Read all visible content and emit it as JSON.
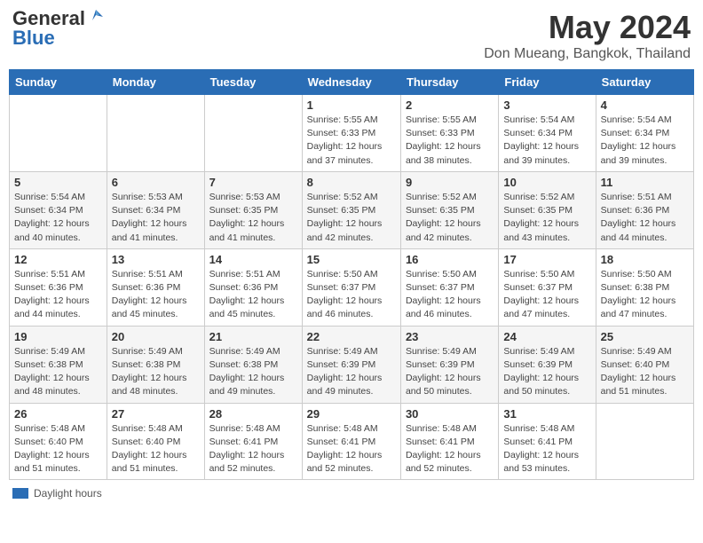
{
  "header": {
    "logo_general": "General",
    "logo_blue": "Blue",
    "title": "May 2024",
    "subtitle": "Don Mueang, Bangkok, Thailand"
  },
  "days_of_week": [
    "Sunday",
    "Monday",
    "Tuesday",
    "Wednesday",
    "Thursday",
    "Friday",
    "Saturday"
  ],
  "footer": {
    "label": "Daylight hours"
  },
  "weeks": [
    [
      {
        "day": "",
        "info": ""
      },
      {
        "day": "",
        "info": ""
      },
      {
        "day": "",
        "info": ""
      },
      {
        "day": "1",
        "info": "Sunrise: 5:55 AM\nSunset: 6:33 PM\nDaylight: 12 hours\nand 37 minutes."
      },
      {
        "day": "2",
        "info": "Sunrise: 5:55 AM\nSunset: 6:33 PM\nDaylight: 12 hours\nand 38 minutes."
      },
      {
        "day": "3",
        "info": "Sunrise: 5:54 AM\nSunset: 6:34 PM\nDaylight: 12 hours\nand 39 minutes."
      },
      {
        "day": "4",
        "info": "Sunrise: 5:54 AM\nSunset: 6:34 PM\nDaylight: 12 hours\nand 39 minutes."
      }
    ],
    [
      {
        "day": "5",
        "info": "Sunrise: 5:54 AM\nSunset: 6:34 PM\nDaylight: 12 hours\nand 40 minutes."
      },
      {
        "day": "6",
        "info": "Sunrise: 5:53 AM\nSunset: 6:34 PM\nDaylight: 12 hours\nand 41 minutes."
      },
      {
        "day": "7",
        "info": "Sunrise: 5:53 AM\nSunset: 6:35 PM\nDaylight: 12 hours\nand 41 minutes."
      },
      {
        "day": "8",
        "info": "Sunrise: 5:52 AM\nSunset: 6:35 PM\nDaylight: 12 hours\nand 42 minutes."
      },
      {
        "day": "9",
        "info": "Sunrise: 5:52 AM\nSunset: 6:35 PM\nDaylight: 12 hours\nand 42 minutes."
      },
      {
        "day": "10",
        "info": "Sunrise: 5:52 AM\nSunset: 6:35 PM\nDaylight: 12 hours\nand 43 minutes."
      },
      {
        "day": "11",
        "info": "Sunrise: 5:51 AM\nSunset: 6:36 PM\nDaylight: 12 hours\nand 44 minutes."
      }
    ],
    [
      {
        "day": "12",
        "info": "Sunrise: 5:51 AM\nSunset: 6:36 PM\nDaylight: 12 hours\nand 44 minutes."
      },
      {
        "day": "13",
        "info": "Sunrise: 5:51 AM\nSunset: 6:36 PM\nDaylight: 12 hours\nand 45 minutes."
      },
      {
        "day": "14",
        "info": "Sunrise: 5:51 AM\nSunset: 6:36 PM\nDaylight: 12 hours\nand 45 minutes."
      },
      {
        "day": "15",
        "info": "Sunrise: 5:50 AM\nSunset: 6:37 PM\nDaylight: 12 hours\nand 46 minutes."
      },
      {
        "day": "16",
        "info": "Sunrise: 5:50 AM\nSunset: 6:37 PM\nDaylight: 12 hours\nand 46 minutes."
      },
      {
        "day": "17",
        "info": "Sunrise: 5:50 AM\nSunset: 6:37 PM\nDaylight: 12 hours\nand 47 minutes."
      },
      {
        "day": "18",
        "info": "Sunrise: 5:50 AM\nSunset: 6:38 PM\nDaylight: 12 hours\nand 47 minutes."
      }
    ],
    [
      {
        "day": "19",
        "info": "Sunrise: 5:49 AM\nSunset: 6:38 PM\nDaylight: 12 hours\nand 48 minutes."
      },
      {
        "day": "20",
        "info": "Sunrise: 5:49 AM\nSunset: 6:38 PM\nDaylight: 12 hours\nand 48 minutes."
      },
      {
        "day": "21",
        "info": "Sunrise: 5:49 AM\nSunset: 6:38 PM\nDaylight: 12 hours\nand 49 minutes."
      },
      {
        "day": "22",
        "info": "Sunrise: 5:49 AM\nSunset: 6:39 PM\nDaylight: 12 hours\nand 49 minutes."
      },
      {
        "day": "23",
        "info": "Sunrise: 5:49 AM\nSunset: 6:39 PM\nDaylight: 12 hours\nand 50 minutes."
      },
      {
        "day": "24",
        "info": "Sunrise: 5:49 AM\nSunset: 6:39 PM\nDaylight: 12 hours\nand 50 minutes."
      },
      {
        "day": "25",
        "info": "Sunrise: 5:49 AM\nSunset: 6:40 PM\nDaylight: 12 hours\nand 51 minutes."
      }
    ],
    [
      {
        "day": "26",
        "info": "Sunrise: 5:48 AM\nSunset: 6:40 PM\nDaylight: 12 hours\nand 51 minutes."
      },
      {
        "day": "27",
        "info": "Sunrise: 5:48 AM\nSunset: 6:40 PM\nDaylight: 12 hours\nand 51 minutes."
      },
      {
        "day": "28",
        "info": "Sunrise: 5:48 AM\nSunset: 6:41 PM\nDaylight: 12 hours\nand 52 minutes."
      },
      {
        "day": "29",
        "info": "Sunrise: 5:48 AM\nSunset: 6:41 PM\nDaylight: 12 hours\nand 52 minutes."
      },
      {
        "day": "30",
        "info": "Sunrise: 5:48 AM\nSunset: 6:41 PM\nDaylight: 12 hours\nand 52 minutes."
      },
      {
        "day": "31",
        "info": "Sunrise: 5:48 AM\nSunset: 6:41 PM\nDaylight: 12 hours\nand 53 minutes."
      },
      {
        "day": "",
        "info": ""
      }
    ]
  ]
}
